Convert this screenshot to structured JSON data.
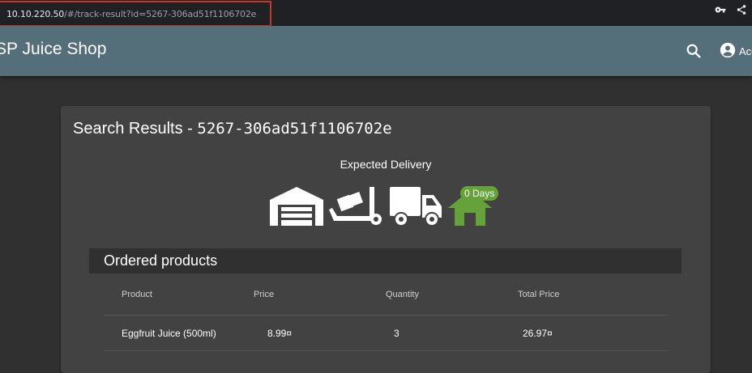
{
  "browser": {
    "url_host": "10.10.220.50",
    "url_path": "/#/track-result?id=5267-306ad51f1106702e",
    "icons": [
      "key-icon",
      "share-icon"
    ]
  },
  "app": {
    "title": "SP Juice Shop",
    "account_label": "Acc",
    "icons": [
      "search-icon",
      "account-circle-icon"
    ]
  },
  "card": {
    "title_prefix": "Search Results - ",
    "order_id": "5267-306ad51f1106702e",
    "expected_delivery_label": "Expected Delivery",
    "days_badge": "0 Days",
    "stage_icons": [
      "warehouse-icon",
      "dolly-icon",
      "truck-icon",
      "home-icon"
    ],
    "active_stage": "home",
    "colors": {
      "active": "#66a23a",
      "inactive": "#ffffff"
    }
  },
  "ordered_products": {
    "heading": "Ordered products",
    "columns": [
      "Product",
      "Price",
      "Quantity",
      "Total Price"
    ],
    "rows": [
      {
        "product": "Eggfruit Juice (500ml)",
        "price": "8.99¤",
        "quantity": "3",
        "total": "26.97¤"
      }
    ]
  }
}
